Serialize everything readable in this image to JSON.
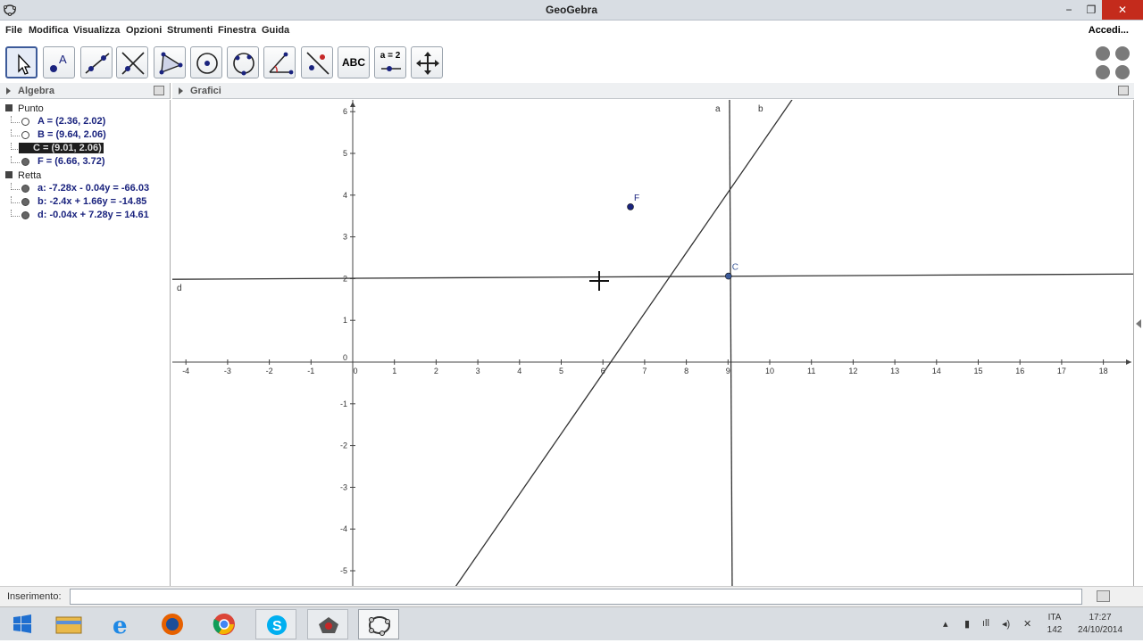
{
  "window": {
    "title": "GeoGebra",
    "minimize": "−",
    "maximize": "❐",
    "close": "✕"
  },
  "menu": {
    "items": [
      "File",
      "Modifica",
      "Visualizza",
      "Opzioni",
      "Strumenti",
      "Finestra",
      "Guida"
    ],
    "login": "Accedi..."
  },
  "toolbar": {
    "tools": [
      "move-tool",
      "point-tool",
      "line-tool",
      "perpendicular-line-tool",
      "polygon-tool",
      "circle-tool",
      "conic-tool",
      "angle-tool",
      "reflect-tool",
      "text-tool",
      "slider-tool",
      "move-graphics-tool"
    ],
    "text_label": "ABC",
    "slider_label": "a = 2"
  },
  "algebra": {
    "header": "Algebra",
    "categories": [
      {
        "name": "Punto",
        "items": [
          {
            "text": "A = (2.36, 2.02)",
            "shown": false,
            "selected": false
          },
          {
            "text": "B = (9.64, 2.06)",
            "shown": false,
            "selected": false
          },
          {
            "text": "C = (9.01, 2.06)",
            "shown": true,
            "selected": true
          },
          {
            "text": "F = (6.66, 3.72)",
            "shown": true,
            "selected": false
          }
        ]
      },
      {
        "name": "Retta",
        "items": [
          {
            "text": "a: -7.28x - 0.04y = -66.03",
            "shown": true,
            "selected": false
          },
          {
            "text": "b: -2.4x + 1.66y = -14.85",
            "shown": true,
            "selected": false
          },
          {
            "text": "d: -0.04x + 7.28y = 14.61",
            "shown": true,
            "selected": false
          }
        ]
      }
    ]
  },
  "graphics": {
    "header": "Grafici",
    "x_ticks": [
      "-4",
      "-3",
      "-2",
      "-1",
      "0",
      "1",
      "2",
      "3",
      "4",
      "5",
      "6",
      "7",
      "8",
      "9",
      "10",
      "11",
      "12",
      "13",
      "14",
      "15",
      "16",
      "17",
      "18"
    ],
    "y_ticks": [
      "6",
      "5",
      "4",
      "3",
      "2",
      "1",
      "0",
      "-1",
      "-2",
      "-3",
      "-4",
      "-5"
    ],
    "points": [
      {
        "label": "F",
        "x": 6.66,
        "y": 3.72,
        "color": "#1a237e"
      },
      {
        "label": "C",
        "x": 9.01,
        "y": 2.06,
        "color": "#3c5a99"
      }
    ],
    "line_labels": {
      "a": "a",
      "b": "b",
      "d": "d"
    }
  },
  "input": {
    "label": "Inserimento:",
    "value": ""
  },
  "taskbar": {
    "lang": "ITA",
    "lang_sub": "142",
    "time": "17:27",
    "date": "24/10/2014"
  }
}
